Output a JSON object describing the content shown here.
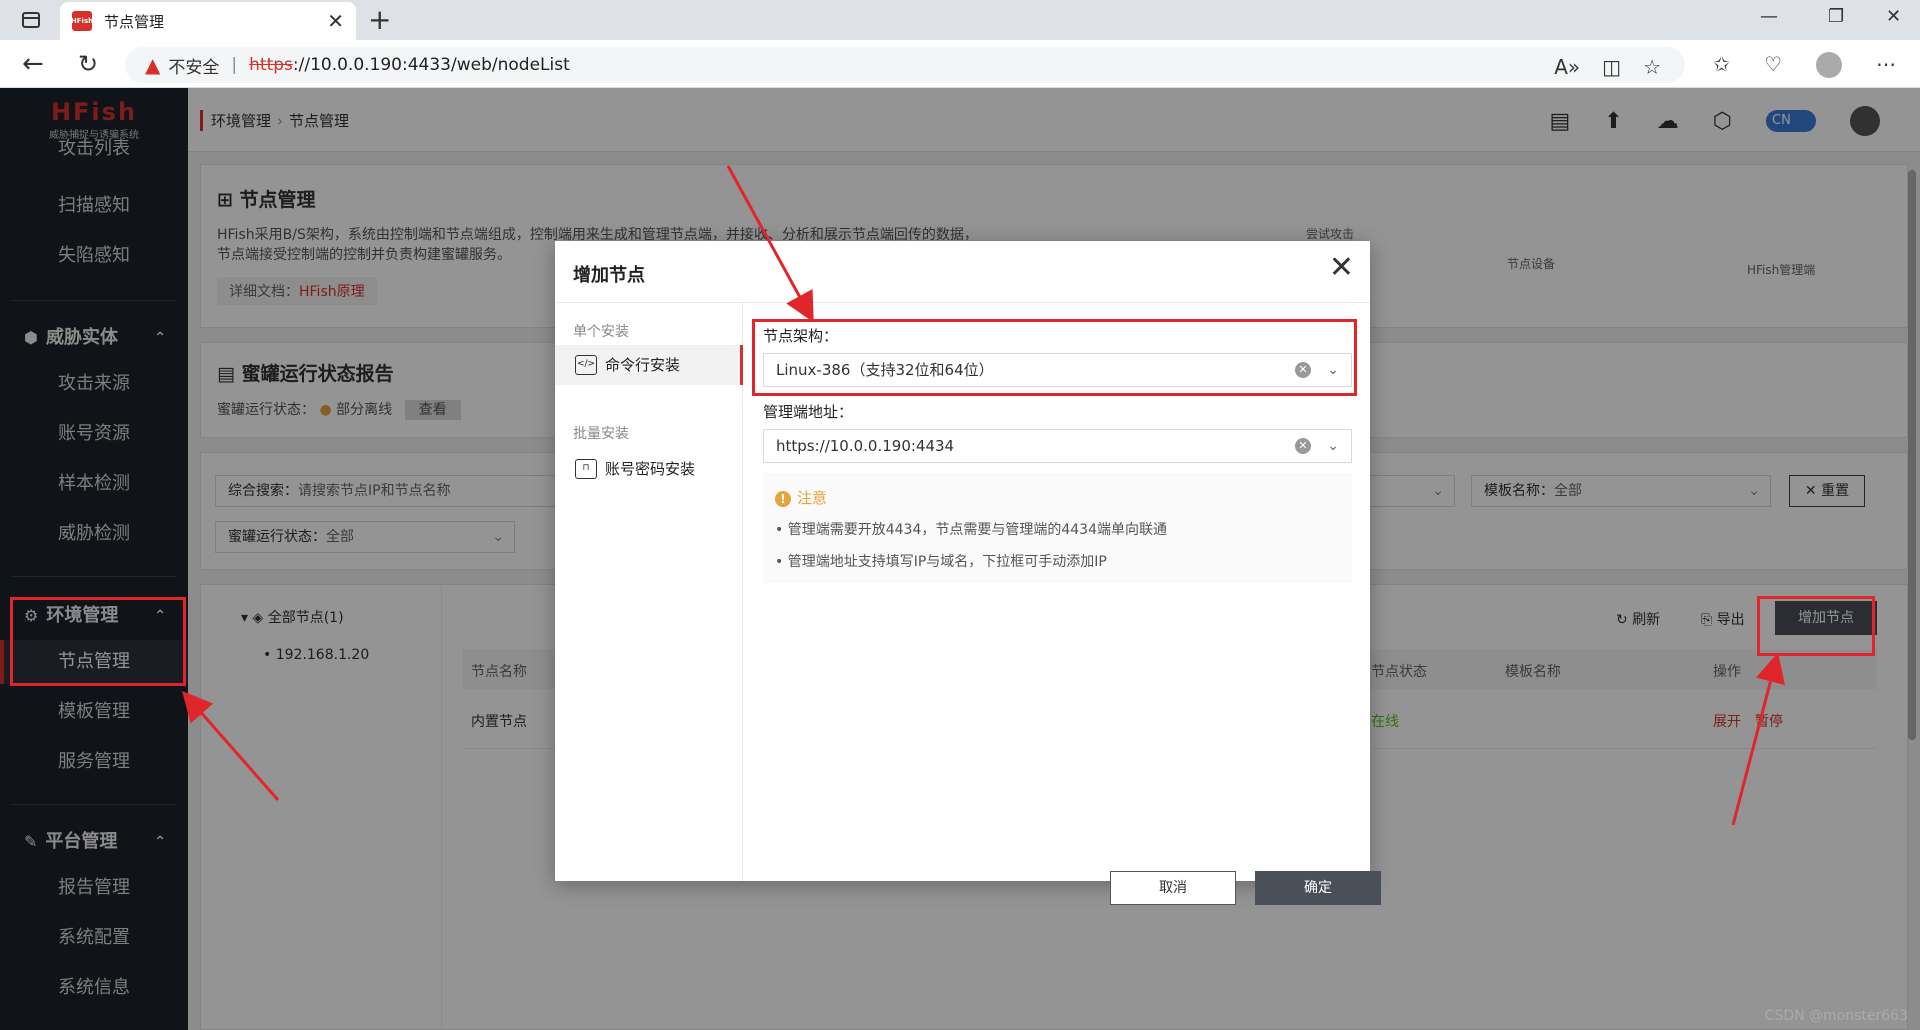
{
  "browser": {
    "tab_title": "节点管理",
    "favicon_text": "HFish",
    "insecure_label": "不安全",
    "url_scheme": "https",
    "url_rest": "://10.0.0.190:4433/web/nodeList"
  },
  "app": {
    "logo": "HFish",
    "logo_sub": "威胁捕捉与诱骗系统",
    "breadcrumb": [
      "环境管理",
      "节点管理"
    ],
    "lang_toggle": "CN"
  },
  "nav": {
    "top_items": [
      "攻击列表",
      "扫描感知",
      "失陷感知"
    ],
    "threat_group": "威胁实体",
    "threat_items": [
      "攻击来源",
      "账号资源",
      "样本检测",
      "威胁检测"
    ],
    "env_group": "环境管理",
    "env_items": [
      "节点管理",
      "模板管理",
      "服务管理"
    ],
    "platform_group": "平台管理",
    "platform_items": [
      "报告管理",
      "系统配置",
      "系统信息"
    ]
  },
  "node_card": {
    "title": "节点管理",
    "desc_line1": "HFish采用B/S架构，系统由控制端和节点端组成，控制端用来生成和管理节点端，并接收、分析和展示节点端回传的数据，",
    "desc_line2": "节点端接受控制端的控制并负责构建蜜罐服务。",
    "doc_prefix": "详细文档：",
    "doc_link": "HFish原理",
    "diagram": {
      "attack": "尝试攻击",
      "node_device": "节点设备",
      "manager": "HFish管理端"
    }
  },
  "status_card": {
    "title": "蜜罐运行状态报告",
    "label": "蜜罐运行状态：",
    "status": "部分离线",
    "view_button": "查看"
  },
  "filters": {
    "search_label": "综合搜索：",
    "search_placeholder": "请搜索节点IP和节点名称",
    "template_label": "模板名称：",
    "template_value": "全部",
    "reset_button": "重置",
    "status_label": "蜜罐运行状态：",
    "status_value": "全部"
  },
  "tree": {
    "root": "全部节点(1)",
    "child": "192.168.1.20"
  },
  "table": {
    "refresh": "刷新",
    "export": "导出",
    "add_node": "增加节点",
    "headers": [
      "节点名称",
      "节点状态",
      "模板名称",
      "操作"
    ],
    "rows": [
      {
        "name": "内置节点",
        "status": "在线",
        "actions": [
          "展开",
          "暂停"
        ]
      }
    ]
  },
  "modal": {
    "title": "增加节点",
    "single_section": "单个安装",
    "cmd_install": "命令行安装",
    "batch_section": "批量安装",
    "account_install": "账号密码安装",
    "arch_label": "节点架构：",
    "arch_value": "Linux-386（支持32位和64位）",
    "addr_label": "管理端地址：",
    "addr_value": "https://10.0.0.190:4434",
    "notice_title": "注意",
    "notice_1": "管理端需要开放4434，节点需要与管理端的4434端单向联通",
    "notice_2": "管理端地址支持填写IP与域名，下拉框可手动添加IP",
    "cancel": "取消",
    "confirm": "确定"
  },
  "watermark": "CSDN @monster663",
  "colors": {
    "accent": "#d7312b",
    "nav_bg": "#1c2129",
    "annotation": "#e0262b"
  }
}
